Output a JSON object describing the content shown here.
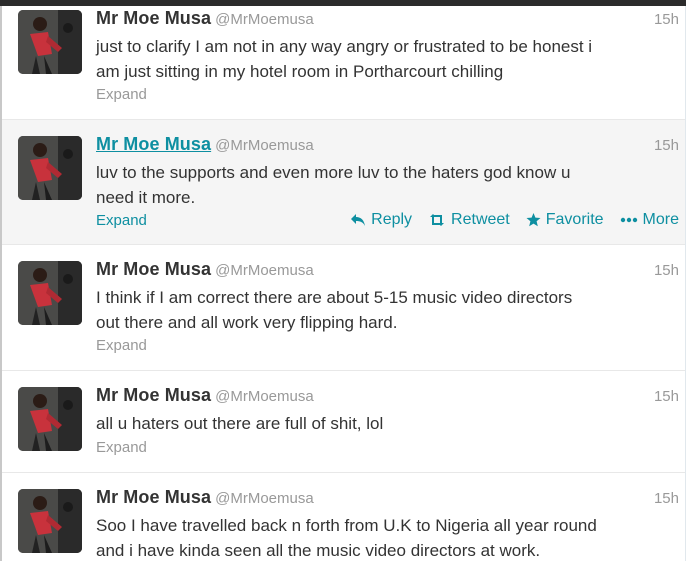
{
  "tweets": [
    {
      "fullname": "Mr Moe Musa",
      "username": "@MrMoemusa",
      "time": "15h",
      "text_line1": "just to clarify I am not in any way angry or frustrated to be honest i",
      "text_line2": "am just sitting in my hotel room in Portharcourt chilling",
      "expand": "Expand"
    },
    {
      "fullname": "Mr Moe Musa",
      "username": "@MrMoemusa",
      "time": "15h",
      "text_line1": "luv to the supports and even more luv to the haters god know u",
      "text_line2": "need it more.",
      "expand": "Expand",
      "actions": {
        "reply": "Reply",
        "retweet": "Retweet",
        "favorite": "Favorite",
        "more": "More"
      }
    },
    {
      "fullname": "Mr Moe Musa",
      "username": "@MrMoemusa",
      "time": "15h",
      "text_line1": "I think if I am correct there are about 5-15 music video directors",
      "text_line2": "out there and all work very flipping hard.",
      "expand": "Expand"
    },
    {
      "fullname": "Mr Moe Musa",
      "username": "@MrMoemusa",
      "time": "15h",
      "text_line1": "all u haters out there are full of shit, lol",
      "expand": "Expand"
    },
    {
      "fullname": "Mr Moe Musa",
      "username": "@MrMoemusa",
      "time": "15h",
      "text_line1": "Soo I have travelled back n forth from U.K to Nigeria all year round",
      "text_line2": "and i have kinda seen all the music video directors at work."
    }
  ],
  "colors": {
    "link": "#0e8fa1",
    "muted": "#999999",
    "text": "#333333",
    "hover_bg": "#f5f5f5"
  },
  "icons": {
    "reply": "reply-arrow-icon",
    "retweet": "retweet-icon",
    "favorite": "star-icon",
    "more": "more-dots-icon"
  }
}
